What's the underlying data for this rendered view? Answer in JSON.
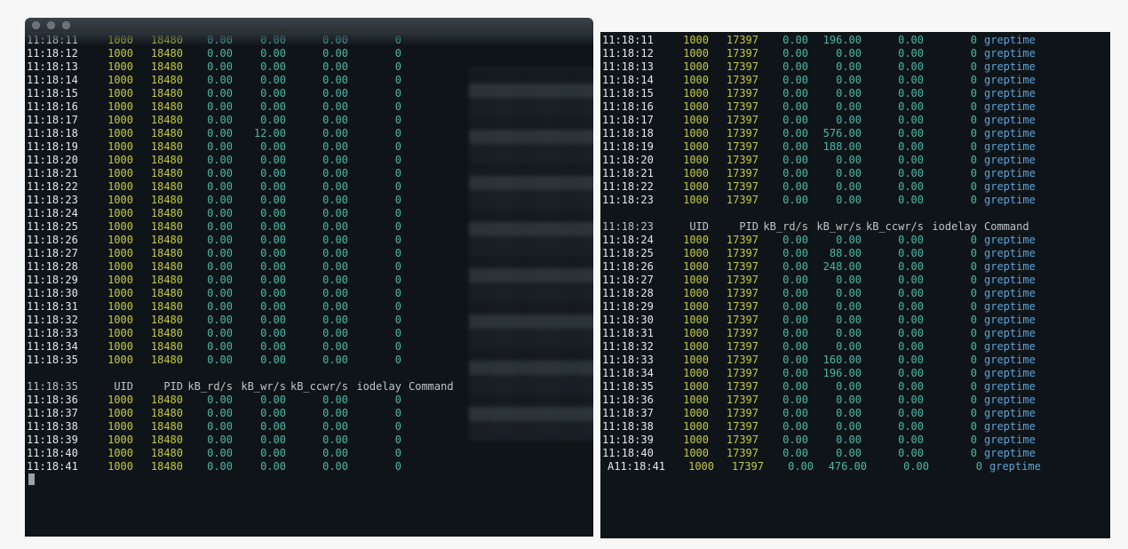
{
  "headers": {
    "time_label": "",
    "uid": "UID",
    "pid": "PID",
    "rd": "kB_rd/s",
    "wr": "kB_wr/s",
    "ccwr": "kB_ccwr/s",
    "iodelay": "iodelay",
    "command": "Command"
  },
  "left": {
    "header_time": "11:18:35",
    "section1": [
      {
        "t": "11:18:11",
        "uid": "1000",
        "pid": "18480",
        "rd": "0.00",
        "wr": "0.00",
        "ccwr": "0.00",
        "d": "0",
        "cmd": ""
      },
      {
        "t": "11:18:12",
        "uid": "1000",
        "pid": "18480",
        "rd": "0.00",
        "wr": "0.00",
        "ccwr": "0.00",
        "d": "0",
        "cmd": ""
      },
      {
        "t": "11:18:13",
        "uid": "1000",
        "pid": "18480",
        "rd": "0.00",
        "wr": "0.00",
        "ccwr": "0.00",
        "d": "0",
        "cmd": ""
      },
      {
        "t": "11:18:14",
        "uid": "1000",
        "pid": "18480",
        "rd": "0.00",
        "wr": "0.00",
        "ccwr": "0.00",
        "d": "0",
        "cmd": ""
      },
      {
        "t": "11:18:15",
        "uid": "1000",
        "pid": "18480",
        "rd": "0.00",
        "wr": "0.00",
        "ccwr": "0.00",
        "d": "0",
        "cmd": ""
      },
      {
        "t": "11:18:16",
        "uid": "1000",
        "pid": "18480",
        "rd": "0.00",
        "wr": "0.00",
        "ccwr": "0.00",
        "d": "0",
        "cmd": ""
      },
      {
        "t": "11:18:17",
        "uid": "1000",
        "pid": "18480",
        "rd": "0.00",
        "wr": "0.00",
        "ccwr": "0.00",
        "d": "0",
        "cmd": ""
      },
      {
        "t": "11:18:18",
        "uid": "1000",
        "pid": "18480",
        "rd": "0.00",
        "wr": "12.00",
        "ccwr": "0.00",
        "d": "0",
        "cmd": ""
      },
      {
        "t": "11:18:19",
        "uid": "1000",
        "pid": "18480",
        "rd": "0.00",
        "wr": "0.00",
        "ccwr": "0.00",
        "d": "0",
        "cmd": ""
      },
      {
        "t": "11:18:20",
        "uid": "1000",
        "pid": "18480",
        "rd": "0.00",
        "wr": "0.00",
        "ccwr": "0.00",
        "d": "0",
        "cmd": ""
      },
      {
        "t": "11:18:21",
        "uid": "1000",
        "pid": "18480",
        "rd": "0.00",
        "wr": "0.00",
        "ccwr": "0.00",
        "d": "0",
        "cmd": ""
      },
      {
        "t": "11:18:22",
        "uid": "1000",
        "pid": "18480",
        "rd": "0.00",
        "wr": "0.00",
        "ccwr": "0.00",
        "d": "0",
        "cmd": ""
      },
      {
        "t": "11:18:23",
        "uid": "1000",
        "pid": "18480",
        "rd": "0.00",
        "wr": "0.00",
        "ccwr": "0.00",
        "d": "0",
        "cmd": ""
      },
      {
        "t": "11:18:24",
        "uid": "1000",
        "pid": "18480",
        "rd": "0.00",
        "wr": "0.00",
        "ccwr": "0.00",
        "d": "0",
        "cmd": ""
      },
      {
        "t": "11:18:25",
        "uid": "1000",
        "pid": "18480",
        "rd": "0.00",
        "wr": "0.00",
        "ccwr": "0.00",
        "d": "0",
        "cmd": ""
      },
      {
        "t": "11:18:26",
        "uid": "1000",
        "pid": "18480",
        "rd": "0.00",
        "wr": "0.00",
        "ccwr": "0.00",
        "d": "0",
        "cmd": ""
      },
      {
        "t": "11:18:27",
        "uid": "1000",
        "pid": "18480",
        "rd": "0.00",
        "wr": "0.00",
        "ccwr": "0.00",
        "d": "0",
        "cmd": ""
      },
      {
        "t": "11:18:28",
        "uid": "1000",
        "pid": "18480",
        "rd": "0.00",
        "wr": "0.00",
        "ccwr": "0.00",
        "d": "0",
        "cmd": ""
      },
      {
        "t": "11:18:29",
        "uid": "1000",
        "pid": "18480",
        "rd": "0.00",
        "wr": "0.00",
        "ccwr": "0.00",
        "d": "0",
        "cmd": ""
      },
      {
        "t": "11:18:30",
        "uid": "1000",
        "pid": "18480",
        "rd": "0.00",
        "wr": "0.00",
        "ccwr": "0.00",
        "d": "0",
        "cmd": ""
      },
      {
        "t": "11:18:31",
        "uid": "1000",
        "pid": "18480",
        "rd": "0.00",
        "wr": "0.00",
        "ccwr": "0.00",
        "d": "0",
        "cmd": ""
      },
      {
        "t": "11:18:32",
        "uid": "1000",
        "pid": "18480",
        "rd": "0.00",
        "wr": "0.00",
        "ccwr": "0.00",
        "d": "0",
        "cmd": ""
      },
      {
        "t": "11:18:33",
        "uid": "1000",
        "pid": "18480",
        "rd": "0.00",
        "wr": "0.00",
        "ccwr": "0.00",
        "d": "0",
        "cmd": ""
      },
      {
        "t": "11:18:34",
        "uid": "1000",
        "pid": "18480",
        "rd": "0.00",
        "wr": "0.00",
        "ccwr": "0.00",
        "d": "0",
        "cmd": ""
      },
      {
        "t": "11:18:35",
        "uid": "1000",
        "pid": "18480",
        "rd": "0.00",
        "wr": "0.00",
        "ccwr": "0.00",
        "d": "0",
        "cmd": ""
      }
    ],
    "section2": [
      {
        "t": "11:18:36",
        "uid": "1000",
        "pid": "18480",
        "rd": "0.00",
        "wr": "0.00",
        "ccwr": "0.00",
        "d": "0",
        "cmd": ""
      },
      {
        "t": "11:18:37",
        "uid": "1000",
        "pid": "18480",
        "rd": "0.00",
        "wr": "0.00",
        "ccwr": "0.00",
        "d": "0",
        "cmd": ""
      },
      {
        "t": "11:18:38",
        "uid": "1000",
        "pid": "18480",
        "rd": "0.00",
        "wr": "0.00",
        "ccwr": "0.00",
        "d": "0",
        "cmd": ""
      },
      {
        "t": "11:18:39",
        "uid": "1000",
        "pid": "18480",
        "rd": "0.00",
        "wr": "0.00",
        "ccwr": "0.00",
        "d": "0",
        "cmd": ""
      },
      {
        "t": "11:18:40",
        "uid": "1000",
        "pid": "18480",
        "rd": "0.00",
        "wr": "0.00",
        "ccwr": "0.00",
        "d": "0",
        "cmd": ""
      },
      {
        "t": "11:18:41",
        "uid": "1000",
        "pid": "18480",
        "rd": "0.00",
        "wr": "0.00",
        "ccwr": "0.00",
        "d": "0",
        "cmd": ""
      }
    ]
  },
  "right": {
    "header_time": "11:18:23",
    "section1": [
      {
        "t": "11:18:11",
        "uid": "1000",
        "pid": "17397",
        "rd": "0.00",
        "wr": "196.00",
        "ccwr": "0.00",
        "d": "0",
        "cmd": "greptime"
      },
      {
        "t": "11:18:12",
        "uid": "1000",
        "pid": "17397",
        "rd": "0.00",
        "wr": "0.00",
        "ccwr": "0.00",
        "d": "0",
        "cmd": "greptime"
      },
      {
        "t": "11:18:13",
        "uid": "1000",
        "pid": "17397",
        "rd": "0.00",
        "wr": "0.00",
        "ccwr": "0.00",
        "d": "0",
        "cmd": "greptime"
      },
      {
        "t": "11:18:14",
        "uid": "1000",
        "pid": "17397",
        "rd": "0.00",
        "wr": "0.00",
        "ccwr": "0.00",
        "d": "0",
        "cmd": "greptime"
      },
      {
        "t": "11:18:15",
        "uid": "1000",
        "pid": "17397",
        "rd": "0.00",
        "wr": "0.00",
        "ccwr": "0.00",
        "d": "0",
        "cmd": "greptime"
      },
      {
        "t": "11:18:16",
        "uid": "1000",
        "pid": "17397",
        "rd": "0.00",
        "wr": "0.00",
        "ccwr": "0.00",
        "d": "0",
        "cmd": "greptime"
      },
      {
        "t": "11:18:17",
        "uid": "1000",
        "pid": "17397",
        "rd": "0.00",
        "wr": "0.00",
        "ccwr": "0.00",
        "d": "0",
        "cmd": "greptime"
      },
      {
        "t": "11:18:18",
        "uid": "1000",
        "pid": "17397",
        "rd": "0.00",
        "wr": "576.00",
        "ccwr": "0.00",
        "d": "0",
        "cmd": "greptime"
      },
      {
        "t": "11:18:19",
        "uid": "1000",
        "pid": "17397",
        "rd": "0.00",
        "wr": "188.00",
        "ccwr": "0.00",
        "d": "0",
        "cmd": "greptime"
      },
      {
        "t": "11:18:20",
        "uid": "1000",
        "pid": "17397",
        "rd": "0.00",
        "wr": "0.00",
        "ccwr": "0.00",
        "d": "0",
        "cmd": "greptime"
      },
      {
        "t": "11:18:21",
        "uid": "1000",
        "pid": "17397",
        "rd": "0.00",
        "wr": "0.00",
        "ccwr": "0.00",
        "d": "0",
        "cmd": "greptime"
      },
      {
        "t": "11:18:22",
        "uid": "1000",
        "pid": "17397",
        "rd": "0.00",
        "wr": "0.00",
        "ccwr": "0.00",
        "d": "0",
        "cmd": "greptime"
      },
      {
        "t": "11:18:23",
        "uid": "1000",
        "pid": "17397",
        "rd": "0.00",
        "wr": "0.00",
        "ccwr": "0.00",
        "d": "0",
        "cmd": "greptime"
      }
    ],
    "section2": [
      {
        "t": "11:18:24",
        "uid": "1000",
        "pid": "17397",
        "rd": "0.00",
        "wr": "0.00",
        "ccwr": "0.00",
        "d": "0",
        "cmd": "greptime"
      },
      {
        "t": "11:18:25",
        "uid": "1000",
        "pid": "17397",
        "rd": "0.00",
        "wr": "88.00",
        "ccwr": "0.00",
        "d": "0",
        "cmd": "greptime"
      },
      {
        "t": "11:18:26",
        "uid": "1000",
        "pid": "17397",
        "rd": "0.00",
        "wr": "248.00",
        "ccwr": "0.00",
        "d": "0",
        "cmd": "greptime"
      },
      {
        "t": "11:18:27",
        "uid": "1000",
        "pid": "17397",
        "rd": "0.00",
        "wr": "0.00",
        "ccwr": "0.00",
        "d": "0",
        "cmd": "greptime"
      },
      {
        "t": "11:18:28",
        "uid": "1000",
        "pid": "17397",
        "rd": "0.00",
        "wr": "0.00",
        "ccwr": "0.00",
        "d": "0",
        "cmd": "greptime"
      },
      {
        "t": "11:18:29",
        "uid": "1000",
        "pid": "17397",
        "rd": "0.00",
        "wr": "0.00",
        "ccwr": "0.00",
        "d": "0",
        "cmd": "greptime"
      },
      {
        "t": "11:18:30",
        "uid": "1000",
        "pid": "17397",
        "rd": "0.00",
        "wr": "0.00",
        "ccwr": "0.00",
        "d": "0",
        "cmd": "greptime"
      },
      {
        "t": "11:18:31",
        "uid": "1000",
        "pid": "17397",
        "rd": "0.00",
        "wr": "0.00",
        "ccwr": "0.00",
        "d": "0",
        "cmd": "greptime"
      },
      {
        "t": "11:18:32",
        "uid": "1000",
        "pid": "17397",
        "rd": "0.00",
        "wr": "0.00",
        "ccwr": "0.00",
        "d": "0",
        "cmd": "greptime"
      },
      {
        "t": "11:18:33",
        "uid": "1000",
        "pid": "17397",
        "rd": "0.00",
        "wr": "160.00",
        "ccwr": "0.00",
        "d": "0",
        "cmd": "greptime"
      },
      {
        "t": "11:18:34",
        "uid": "1000",
        "pid": "17397",
        "rd": "0.00",
        "wr": "196.00",
        "ccwr": "0.00",
        "d": "0",
        "cmd": "greptime"
      },
      {
        "t": "11:18:35",
        "uid": "1000",
        "pid": "17397",
        "rd": "0.00",
        "wr": "0.00",
        "ccwr": "0.00",
        "d": "0",
        "cmd": "greptime"
      },
      {
        "t": "11:18:36",
        "uid": "1000",
        "pid": "17397",
        "rd": "0.00",
        "wr": "0.00",
        "ccwr": "0.00",
        "d": "0",
        "cmd": "greptime"
      },
      {
        "t": "11:18:37",
        "uid": "1000",
        "pid": "17397",
        "rd": "0.00",
        "wr": "0.00",
        "ccwr": "0.00",
        "d": "0",
        "cmd": "greptime"
      },
      {
        "t": "11:18:38",
        "uid": "1000",
        "pid": "17397",
        "rd": "0.00",
        "wr": "0.00",
        "ccwr": "0.00",
        "d": "0",
        "cmd": "greptime"
      },
      {
        "t": "11:18:39",
        "uid": "1000",
        "pid": "17397",
        "rd": "0.00",
        "wr": "0.00",
        "ccwr": "0.00",
        "d": "0",
        "cmd": "greptime"
      },
      {
        "t": "11:18:40",
        "uid": "1000",
        "pid": "17397",
        "rd": "0.00",
        "wr": "0.00",
        "ccwr": "0.00",
        "d": "0",
        "cmd": "greptime"
      }
    ],
    "last": {
      "t": "A11:18:41",
      "uid": "1000",
      "pid": "17397",
      "rd": "0.00",
      "wr": "476.00",
      "ccwr": "0.00",
      "d": "0",
      "cmd": "greptime"
    }
  }
}
